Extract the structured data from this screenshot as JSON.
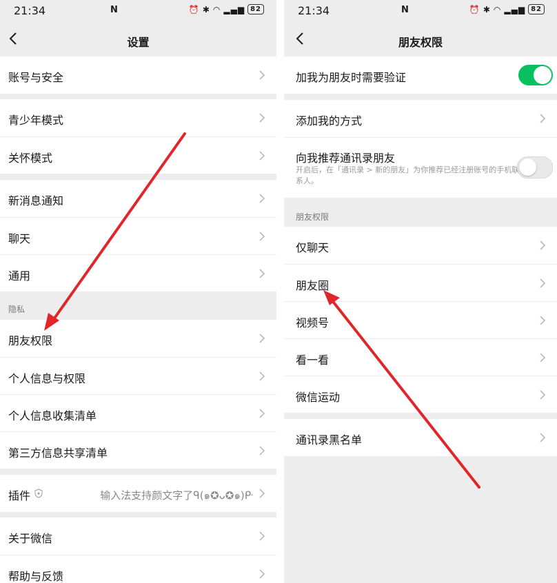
{
  "status_bar": {
    "time": "21:34",
    "battery": "82"
  },
  "left": {
    "title": "设置",
    "items": {
      "account_security": "账号与安全",
      "youth_mode": "青少年模式",
      "care_mode": "关怀模式",
      "new_message": "新消息通知",
      "chat": "聊天",
      "general": "通用",
      "privacy_header": "隐私",
      "friend_permissions": "朋友权限",
      "personal_info_perm": "个人信息与权限",
      "personal_info_list": "个人信息收集清单",
      "third_party_list": "第三方信息共享清单",
      "plugins": "插件",
      "plugins_value": "输入法支持颜文字了ᑫ(๑✪ᴗ✪๑)ᑷ",
      "about": "关于微信",
      "help": "帮助与反馈"
    }
  },
  "right": {
    "title": "朋友权限",
    "items": {
      "verify": "加我为朋友时需要验证",
      "add_methods": "添加我的方式",
      "recommend_contacts": "向我推荐通讯录朋友",
      "recommend_desc": "开启后，在「通讯录 > 新的朋友」为你推荐已经注册账号的手机联系人。",
      "section_header": "朋友权限",
      "chat_only": "仅聊天",
      "moments": "朋友圈",
      "channels": "视频号",
      "top_stories": "看一看",
      "werun": "微信运动",
      "blacklist": "通讯录黑名单"
    },
    "toggles": {
      "verify": true,
      "recommend_contacts": false
    }
  },
  "colors": {
    "toggle_on": "#07c160",
    "arrow": "#e0262a",
    "background": "#ededed"
  }
}
